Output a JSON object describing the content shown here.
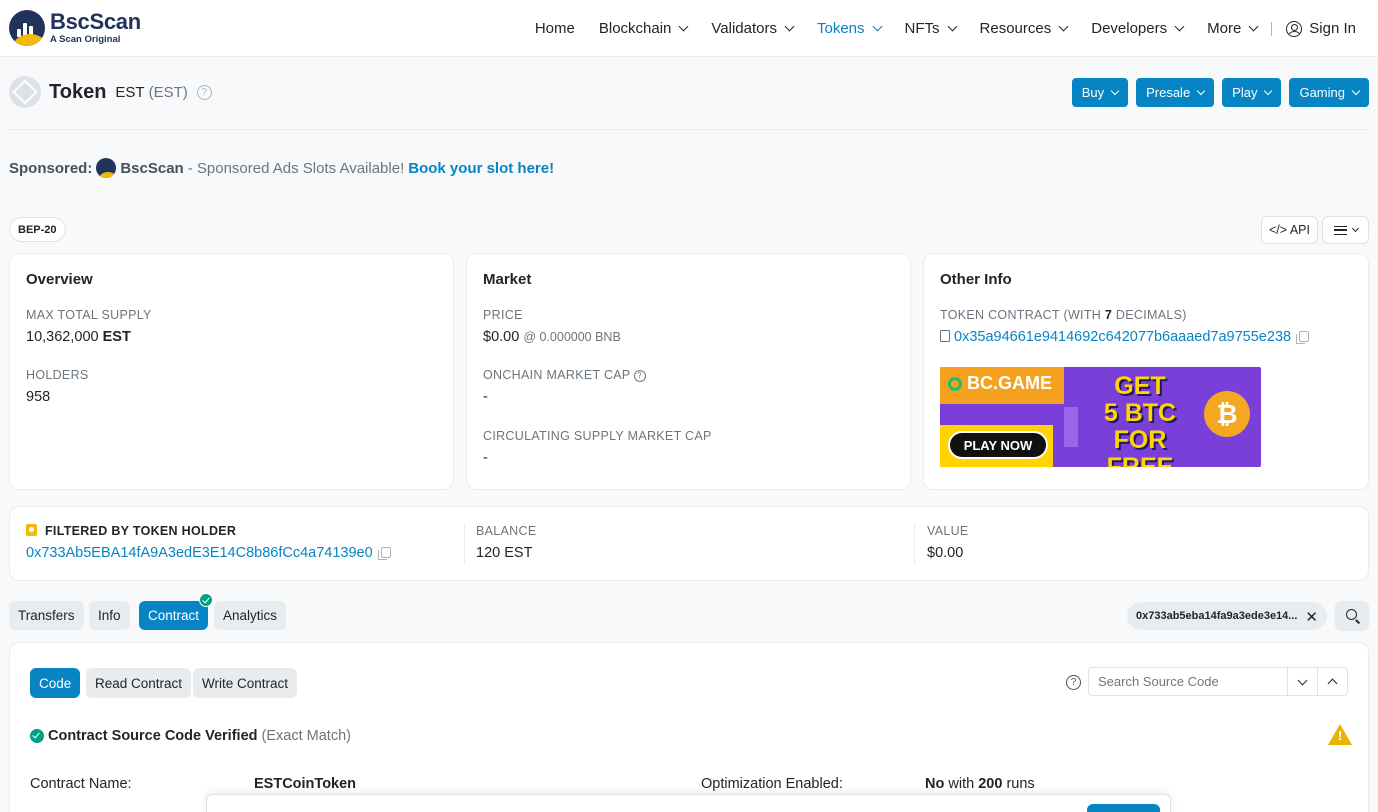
{
  "header": {
    "logo_name": "BscScan",
    "logo_tagline": "A Scan Original",
    "nav": [
      {
        "label": "Home",
        "dropdown": false,
        "active": false
      },
      {
        "label": "Blockchain",
        "dropdown": true,
        "active": false
      },
      {
        "label": "Validators",
        "dropdown": true,
        "active": false
      },
      {
        "label": "Tokens",
        "dropdown": true,
        "active": true
      },
      {
        "label": "NFTs",
        "dropdown": true,
        "active": false
      },
      {
        "label": "Resources",
        "dropdown": true,
        "active": false
      },
      {
        "label": "Developers",
        "dropdown": true,
        "active": false
      },
      {
        "label": "More",
        "dropdown": true,
        "active": false
      }
    ],
    "sign_in": "Sign In"
  },
  "title": {
    "word": "Token",
    "name": "EST",
    "symbol": "(EST)",
    "help": "?"
  },
  "actions": [
    "Buy",
    "Presale",
    "Play",
    "Gaming"
  ],
  "sponsored": {
    "label": "Sponsored:",
    "brand": "BscScan",
    "text": "- Sponsored Ads Slots Available!",
    "link": "Book your slot here!"
  },
  "badge": "BEP-20",
  "api_button": "</> API",
  "overview": {
    "title": "Overview",
    "max_supply_label": "MAX TOTAL SUPPLY",
    "max_supply_value": "10,362,000",
    "max_supply_unit": "EST",
    "holders_label": "HOLDERS",
    "holders_value": "958"
  },
  "market": {
    "title": "Market",
    "price_label": "PRICE",
    "price_value": "$0.00",
    "price_bnb": "@ 0.000000 BNB",
    "onchain_cap_label": "ONCHAIN MARKET CAP",
    "onchain_cap_value": "-",
    "circ_cap_label": "CIRCULATING SUPPLY MARKET CAP",
    "circ_cap_value": "-"
  },
  "other_info": {
    "title": "Other Info",
    "contract_label_prefix": "TOKEN CONTRACT (WITH",
    "decimals": "7",
    "contract_label_suffix": "DECIMALS)",
    "contract_address": "0x35a94661e9414692c642077b6aaaed7a9755e238"
  },
  "ad": {
    "brand": "BC.GAME",
    "headline": "GET\n5 BTC\nFOR FREE",
    "cta": "PLAY NOW",
    "coin": "₿"
  },
  "filter": {
    "label": "FILTERED BY TOKEN HOLDER",
    "address": "0x733Ab5EBA14fA9A3edE3E14C8b86fCc4a74139e0",
    "balance_label": "BALANCE",
    "balance_value": "120 EST",
    "value_label": "VALUE",
    "value_value": "$0.00"
  },
  "tabs": [
    "Transfers",
    "Info",
    "Contract",
    "Analytics"
  ],
  "address_chip": "0x733ab5eba14fa9a3ede3e14...",
  "address_chip_close": "✕",
  "contract": {
    "subtabs": [
      "Code",
      "Read Contract",
      "Write Contract"
    ],
    "search_placeholder": "Search Source Code",
    "help": "?",
    "verified_text": "Contract Source Code Verified",
    "verified_match": "(Exact Match)",
    "name_label": "Contract Name:",
    "name_value": "ESTCoinToken",
    "opt_label": "Optimization Enabled:",
    "opt_value": "No",
    "opt_with": "with",
    "opt_runs": "200",
    "opt_runs_suffix": "runs"
  },
  "colors": {
    "accent": "#0784c3",
    "success": "#00a186",
    "warning": "#e8b400",
    "brand_navy": "#21325b",
    "brand_gold": "#f0b90b"
  }
}
